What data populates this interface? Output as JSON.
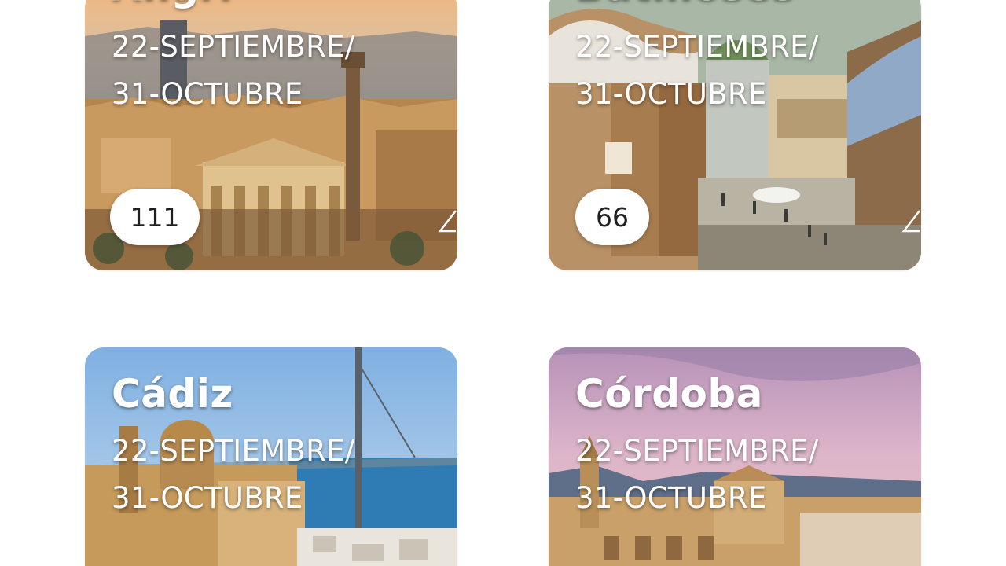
{
  "cards": [
    {
      "title": "Angri",
      "dates_line1": "22-SEPTIEMBRE/",
      "dates_line2": "31-OCTUBRE",
      "count": "111"
    },
    {
      "title": "Batilloses",
      "dates_line1": "22-SEPTIEMBRE/",
      "dates_line2": "31-OCTUBRE",
      "count": "66"
    },
    {
      "title": "Cádiz",
      "dates_line1": "22-SEPTIEMBRE/",
      "dates_line2": "31-OCTUBRE"
    },
    {
      "title": "Córdoba",
      "dates_line1": "22-SEPTIEMBRE/",
      "dates_line2": "31-OCTUBRE"
    }
  ]
}
